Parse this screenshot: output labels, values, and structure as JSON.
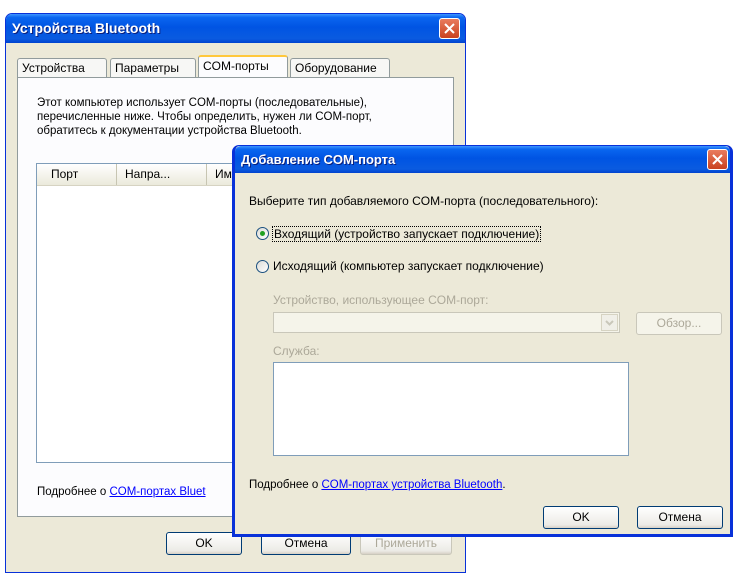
{
  "back_window": {
    "title": "Устройства Bluetooth",
    "tabs": [
      "Устройства",
      "Параметры",
      "COM-порты",
      "Оборудование"
    ],
    "active_tab": "COM-порты",
    "description_lines": [
      "Этот компьютер использует COM-порты (последовательные),",
      "перечисленные ниже. Чтобы определить, нужен ли COM-порт,",
      "обратитесь к документации устройства Bluetooth."
    ],
    "columns": [
      "Порт",
      "Напра...",
      "Имя"
    ],
    "more_prefix": "Подробнее о ",
    "more_link": "COM-портах Bluet",
    "buttons": {
      "ok": "OK",
      "cancel": "Отмена",
      "apply": "Применить"
    }
  },
  "dialog": {
    "title": "Добавление COM-порта",
    "prompt": "Выберите тип добавляемого COM-порта (последовательного):",
    "radio_incoming": "Входящий (устройство запускает подключение)",
    "radio_outgoing": "Исходящий (компьютер запускает подключение)",
    "selected": "incoming",
    "device_label": "Устройство, использующее COM-порт:",
    "device_value": "",
    "browse_button": "Обзор...",
    "service_label": "Служба:",
    "more_prefix": "Подробнее о ",
    "more_link": "COM-портах устройства Bluetooth",
    "more_suffix": ".",
    "ok": "OK",
    "cancel": "Отмена"
  },
  "colors": {
    "xp_blue": "#0054e3",
    "face": "#ece9d8",
    "close_red": "#c9411f"
  },
  "icons": [
    "close-icon",
    "chevron-down-icon"
  ]
}
